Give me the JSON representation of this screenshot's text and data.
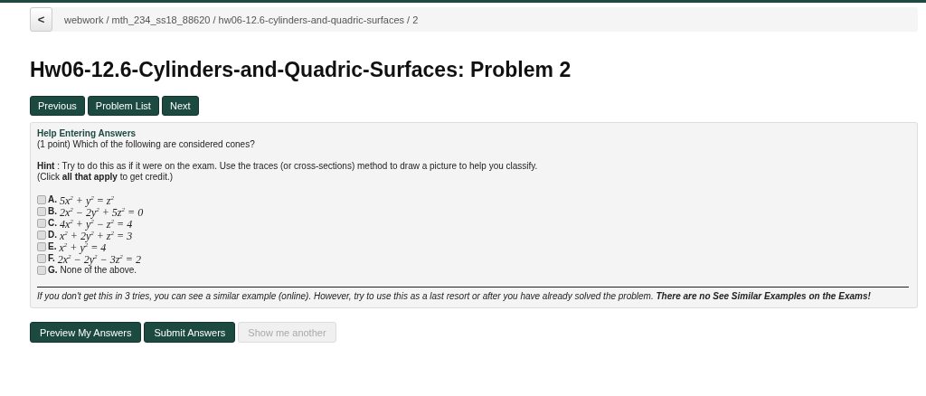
{
  "breadcrumb": {
    "back": "<",
    "path": "webwork / mth_234_ss18_88620 / hw06-12.6-cylinders-and-quadric-surfaces / 2"
  },
  "title": "Hw06-12.6-Cylinders-and-Quadric-Surfaces: Problem 2",
  "nav_buttons": [
    "Previous",
    "Problem List",
    "Next"
  ],
  "problem": {
    "help_link": "Help Entering Answers",
    "question": "(1 point) Which of the following are considered cones?",
    "hint": "**Hint** : Try to do this as if it were on the exam. Use the traces (or cross-sections) method to draw a picture to help you classify.",
    "instruction": "(Click **all that apply** to get credit.)",
    "options": [
      {
        "letter": "A.",
        "text": "5x$^{2}$ + y$^{2}$ = z$^{2}$",
        "kind": "math",
        "checked": false
      },
      {
        "letter": "B.",
        "text": "2x$^{2}$ − 2y$^{2}$ + 5z$^{2}$ = 0",
        "kind": "math",
        "checked": false
      },
      {
        "letter": "C.",
        "text": "4x$^{2}$ + y$^{2}$ − z$^{2}$ = 4",
        "kind": "math",
        "checked": false
      },
      {
        "letter": "D.",
        "text": "x$^{2}$ + 2y$^{2}$ + z$^{2}$ = 3",
        "kind": "math",
        "checked": false
      },
      {
        "letter": "E.",
        "text": "x$^{2}$ + y$^{2}$ = 4",
        "kind": "math",
        "checked": false
      },
      {
        "letter": "F.",
        "text": "2x$^{2}$ − 2y$^{2}$ − 3z$^{2}$ = 2",
        "kind": "math",
        "checked": false
      },
      {
        "letter": "G.",
        "text": "None of the above.",
        "kind": "text",
        "checked": false
      }
    ],
    "note": "If you don't get this in 3 tries, you can see a similar example (online). However, try to use this as a last resort or after you have already solved the problem. **There are no See Similar Examples on the Exams!**"
  },
  "action_buttons": [
    {
      "label": "Preview My Answers",
      "disabled": false
    },
    {
      "label": "Submit Answers",
      "disabled": false
    },
    {
      "label": "Show me another",
      "disabled": true
    }
  ]
}
